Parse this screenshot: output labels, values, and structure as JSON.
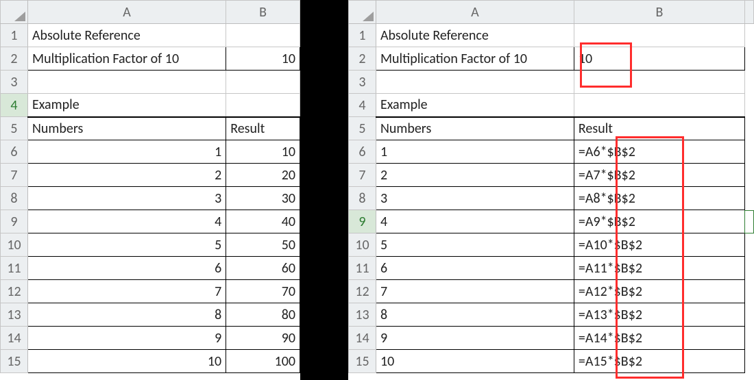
{
  "left": {
    "col_headers": [
      "A",
      "B"
    ],
    "row_headers": [
      "1",
      "2",
      "3",
      "4",
      "5",
      "6",
      "7",
      "8",
      "9",
      "10",
      "11",
      "12",
      "13",
      "14",
      "15"
    ],
    "selected_row_header": "4",
    "r1a": "Absolute Reference",
    "r2a": "Multiplication Factor of 10",
    "r2b": "10",
    "r4a": "Example",
    "r5a": "Numbers",
    "r5b": "Result",
    "rows": [
      {
        "a": "1",
        "b": "10"
      },
      {
        "a": "2",
        "b": "20"
      },
      {
        "a": "3",
        "b": "30"
      },
      {
        "a": "4",
        "b": "40"
      },
      {
        "a": "5",
        "b": "50"
      },
      {
        "a": "6",
        "b": "60"
      },
      {
        "a": "7",
        "b": "70"
      },
      {
        "a": "8",
        "b": "80"
      },
      {
        "a": "9",
        "b": "90"
      },
      {
        "a": "10",
        "b": "100"
      }
    ]
  },
  "right": {
    "col_headers": [
      "A",
      "B"
    ],
    "row_headers": [
      "1",
      "2",
      "3",
      "4",
      "5",
      "6",
      "7",
      "8",
      "9",
      "10",
      "11",
      "12",
      "13",
      "14",
      "15"
    ],
    "selected_row_header": "9",
    "r1a": "Absolute Reference",
    "r2a": "Multiplication Factor of 10",
    "r2b": "10",
    "r4a": "Example",
    "r5a": "Numbers",
    "r5b": "Result",
    "rows": [
      {
        "a": "1",
        "b": "=A6*$B$2"
      },
      {
        "a": "2",
        "b": "=A7*$B$2"
      },
      {
        "a": "3",
        "b": "=A8*$B$2"
      },
      {
        "a": "4",
        "b": "=A9*$B$2"
      },
      {
        "a": "5",
        "b": "=A10*$B$2"
      },
      {
        "a": "6",
        "b": "=A11*$B$2"
      },
      {
        "a": "7",
        "b": "=A12*$B$2"
      },
      {
        "a": "8",
        "b": "=A13*$B$2"
      },
      {
        "a": "9",
        "b": "=A14*$B$2"
      },
      {
        "a": "10",
        "b": "=A15*$B$2"
      }
    ]
  }
}
